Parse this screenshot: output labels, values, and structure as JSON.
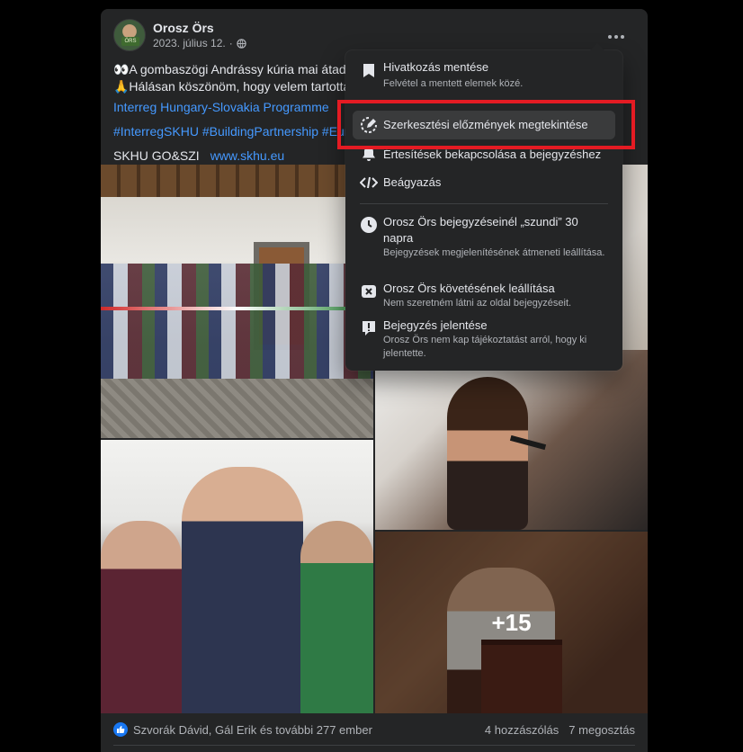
{
  "post": {
    "author": "Orosz Örs",
    "date": "2023. július 12.",
    "date_separator": "·",
    "text_line1": "👀A gombaszögi Andrássy kúria mai átadója",
    "text_line2": "🙏Hálásan köszönöm, hogy velem tartottato",
    "link1": "Interreg Hungary-Slovakia Programme",
    "hashtags": "#InterregSKHU #BuildingPartnership #Euro",
    "skhu_label": "SKHU GO&SZI",
    "skhu_url": "www.skhu.eu",
    "more_photos": "+15",
    "reactors": "Szvorák Dávid, Gál Erik és további 277 ember",
    "comments": "4 hozzászólás",
    "shares": "7 megosztás"
  },
  "menu": {
    "items": [
      {
        "icon": "bookmark-icon",
        "title": "Hivatkozás mentése",
        "subtitle": "Felvétel a mentett elemek közé."
      },
      {
        "icon": "edit-history-icon",
        "title": "Szerkesztési előzmények megtekintése",
        "subtitle": ""
      },
      {
        "icon": "bell-icon",
        "title": "Értesítések bekapcsolása a bejegyzéshez",
        "subtitle": ""
      },
      {
        "icon": "code-icon",
        "title": "Beágyazás",
        "subtitle": ""
      },
      {
        "icon": "clock-icon",
        "title": "Orosz Örs bejegyzéseinél „szundi” 30 napra",
        "subtitle": "Bejegyzések megjelenítésének átmeneti leállítása."
      },
      {
        "icon": "unfollow-icon",
        "title": "Orosz Örs követésének leállítása",
        "subtitle": "Nem szeretném látni az oldal bejegyzéseit."
      },
      {
        "icon": "report-icon",
        "title": "Bejegyzés jelentése",
        "subtitle": "Orosz Örs nem kap tájékoztatást arról, hogy ki jelentette."
      }
    ]
  },
  "colors": {
    "background": "#000000",
    "card": "#242526",
    "link": "#4599ff",
    "highlight": "#e41b23",
    "like": "#1877f2"
  }
}
